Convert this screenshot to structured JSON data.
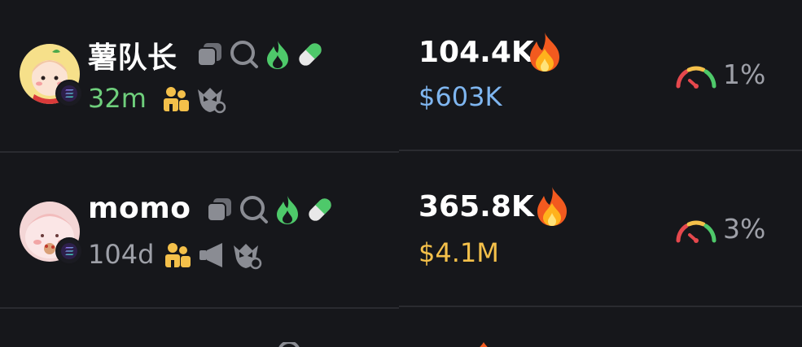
{
  "rows": [
    {
      "name": "薯队长",
      "age": "32m",
      "holders": "104.4K",
      "market_cap": "$603K",
      "percent": "1%",
      "tag_icons": [
        "copy-icon",
        "search-icon",
        "flame-icon",
        "pill-icon"
      ],
      "sub_icons": [
        "people-icon",
        "owl-icon"
      ]
    },
    {
      "name": "momo",
      "age": "104d",
      "holders": "365.8K",
      "market_cap": "$4.1M",
      "percent": "3%",
      "tag_icons": [
        "copy-icon",
        "search-icon",
        "flame-icon",
        "pill-icon"
      ],
      "sub_icons": [
        "people-icon",
        "megaphone-icon",
        "owl-icon"
      ]
    }
  ],
  "colors": {
    "background": "#16171b",
    "age_recent": "#6fcf7c",
    "age_old": "#9ea0a8",
    "market_cap_low": "#7fb6f0",
    "market_cap_high": "#f4c04a",
    "people_icon": "#f4c04a",
    "flame_icon": "#4ec96a"
  }
}
